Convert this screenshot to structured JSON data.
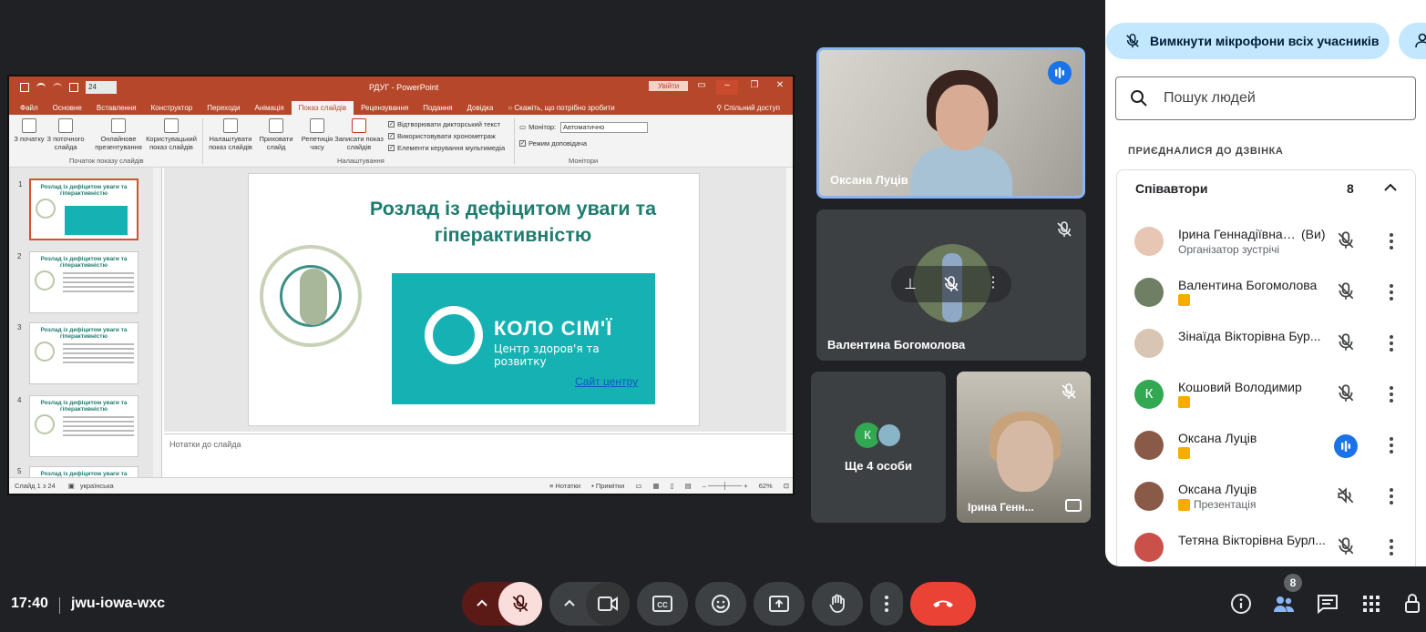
{
  "ppt": {
    "font_size": "24",
    "doc_title": "РДУГ  -  PowerPoint",
    "signin": "Увійти",
    "tabs": [
      "Файл",
      "Основне",
      "Вставлення",
      "Конструктор",
      "Переходи",
      "Анімація",
      "Показ слайдів",
      "Рецензування",
      "Подання",
      "Довідка",
      "Скажіть, що потрібно зробити"
    ],
    "share": "Спільний доступ",
    "ribbon": {
      "from_start": "З початку",
      "from_current": "З поточного слайда",
      "online": "Онлайнове презентування",
      "custom": "Користувацький показ слайдів",
      "group_start": "Початок показу слайдів",
      "setup": "Налаштувати показ слайдів",
      "hide": "Приховати слайд",
      "rehearse": "Репетиція часу",
      "record": "Записати показ слайдів",
      "chk_narration": "Відтворювати дикторський текст",
      "chk_timings": "Використовувати хронометраж",
      "chk_media": "Елементи керування мультимедіа",
      "group_setup": "Налаштування",
      "monitor_label": "Монітор:",
      "monitor_value": "Автоматично",
      "presenter": "Режим доповідача",
      "group_monitors": "Монітори"
    },
    "thumb_title": "Розлад із дефіцитом уваги та гіперактивністю",
    "thumbs": [
      "1",
      "2",
      "3",
      "4",
      "5"
    ],
    "slide": {
      "title": "Розлад із дефіцитом уваги та гіперактивністю",
      "brand": "КОЛО СІМ'Ї",
      "brand_sub": "Центр здоров'я та розвитку",
      "link": "Сайт центру"
    },
    "notes": "Нотатки до слайда",
    "status": {
      "slide": "Слайд 1 з 24",
      "lang": "українська",
      "notes": "Нотатки",
      "comments": "Примітки",
      "zoom": "62%"
    }
  },
  "tiles": {
    "oksana": "Оксана Луців",
    "valentina": "Валентина Богомолова",
    "more_initial": "К",
    "more": "Ще 4 особи",
    "iryna": "Ірина Генн..."
  },
  "panel": {
    "mute_all": "Вимкнути мікрофони всіх учасників",
    "search_placeholder": "Пошук людей",
    "joined": "ПРИЄДНАЛИСЯ ДО ДЗВІНКА",
    "group": "Співавтори",
    "count": "8",
    "people": [
      {
        "name": "Ірина Геннадіївна ...",
        "you": "(Ви)",
        "role": "Організатор зустрічі",
        "state": "muted"
      },
      {
        "name": "Валентина Богомолова",
        "role": "",
        "state": "muted"
      },
      {
        "name": "Зінаїда Вікторівна Бур...",
        "role": "",
        "state": "muted"
      },
      {
        "name": "Кошовий Володимир",
        "role": "",
        "state": "muted"
      },
      {
        "name": "Оксана Луців",
        "role": "",
        "state": "speaking"
      },
      {
        "name": "Оксана Луців",
        "role": "Презентація",
        "state": "presenting"
      },
      {
        "name": "Тетяна Вікторівна Бурл...",
        "role": "",
        "state": "muted"
      }
    ]
  },
  "bar": {
    "time": "17:40",
    "meeting_code": "jwu-iowa-wxc",
    "people_count": "8"
  },
  "colors": {
    "accent_blue": "#1a73e8",
    "end_call": "#ea4335",
    "mic_off": "#f9dedc",
    "ppt_brand": "#b7472a",
    "teal": "#16b2b3"
  }
}
